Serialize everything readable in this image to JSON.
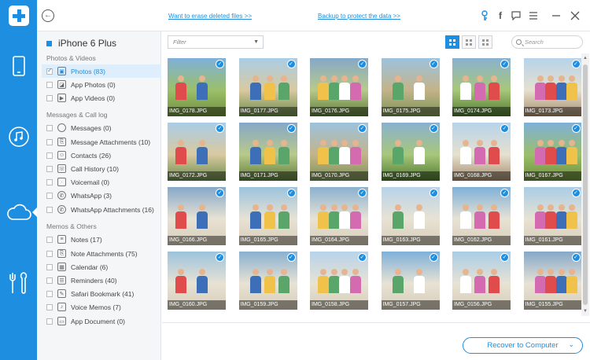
{
  "topbar": {
    "link_erase": "Want to erase deleted files >>",
    "link_backup": "Backup to protect the data >>"
  },
  "sidebar": {
    "device": "iPhone 6 Plus",
    "sections": [
      {
        "title": "Photos & Videos",
        "items": [
          {
            "label": "Photos (83)",
            "selected": true,
            "icon": "image-icon"
          },
          {
            "label": "App Photos (0)",
            "icon": "app-photo-icon"
          },
          {
            "label": "App Videos (0)",
            "icon": "video-icon"
          }
        ]
      },
      {
        "title": "Messages & Call log",
        "items": [
          {
            "label": "Messages (0)",
            "icon": "message-icon"
          },
          {
            "label": "Message Attachments (10)",
            "icon": "attachment-icon"
          },
          {
            "label": "Contacts (26)",
            "icon": "contact-icon"
          },
          {
            "label": "Call History (10)",
            "icon": "phone-icon"
          },
          {
            "label": "Voicemail (0)",
            "icon": "voicemail-icon"
          },
          {
            "label": "WhatsApp (3)",
            "icon": "whatsapp-icon"
          },
          {
            "label": "WhatsApp Attachments (16)",
            "icon": "whatsapp-attachment-icon"
          }
        ]
      },
      {
        "title": "Memos & Others",
        "items": [
          {
            "label": "Notes (17)",
            "icon": "notes-icon"
          },
          {
            "label": "Note Attachments (75)",
            "icon": "note-attachment-icon"
          },
          {
            "label": "Calendar (6)",
            "icon": "calendar-icon"
          },
          {
            "label": "Reminders (40)",
            "icon": "reminder-icon"
          },
          {
            "label": "Safari Bookmark (41)",
            "icon": "bookmark-icon"
          },
          {
            "label": "Voice Memos (7)",
            "icon": "voice-memo-icon"
          },
          {
            "label": "App Document (0)",
            "icon": "document-icon"
          }
        ]
      }
    ]
  },
  "toolbar": {
    "filter_placeholder": "Filter",
    "search_placeholder": "Search"
  },
  "photos": [
    "IMG_0178.JPG",
    "IMG_0177.JPG",
    "IMG_0176.JPG",
    "IMG_0175.JPG",
    "IMG_0174.JPG",
    "IMG_0173.JPG",
    "IMG_0172.JPG",
    "IMG_0171.JPG",
    "IMG_0170.JPG",
    "IMG_0169.JPG",
    "IMG_0168.JPG",
    "IMG_0167.JPG",
    "IMG_0166.JPG",
    "IMG_0165.JPG",
    "IMG_0164.JPG",
    "IMG_0163.JPG",
    "IMG_0162.JPG",
    "IMG_0161.JPG",
    "IMG_0160.JPG",
    "IMG_0159.JPG",
    "IMG_0158.JPG",
    "IMG_0157.JPG",
    "IMG_0156.JPG",
    "IMG_0155.JPG",
    "",
    "",
    "",
    "",
    "",
    ""
  ],
  "recover_button": "Recover to Computer",
  "colors": {
    "accent": "#1e8ee0"
  }
}
